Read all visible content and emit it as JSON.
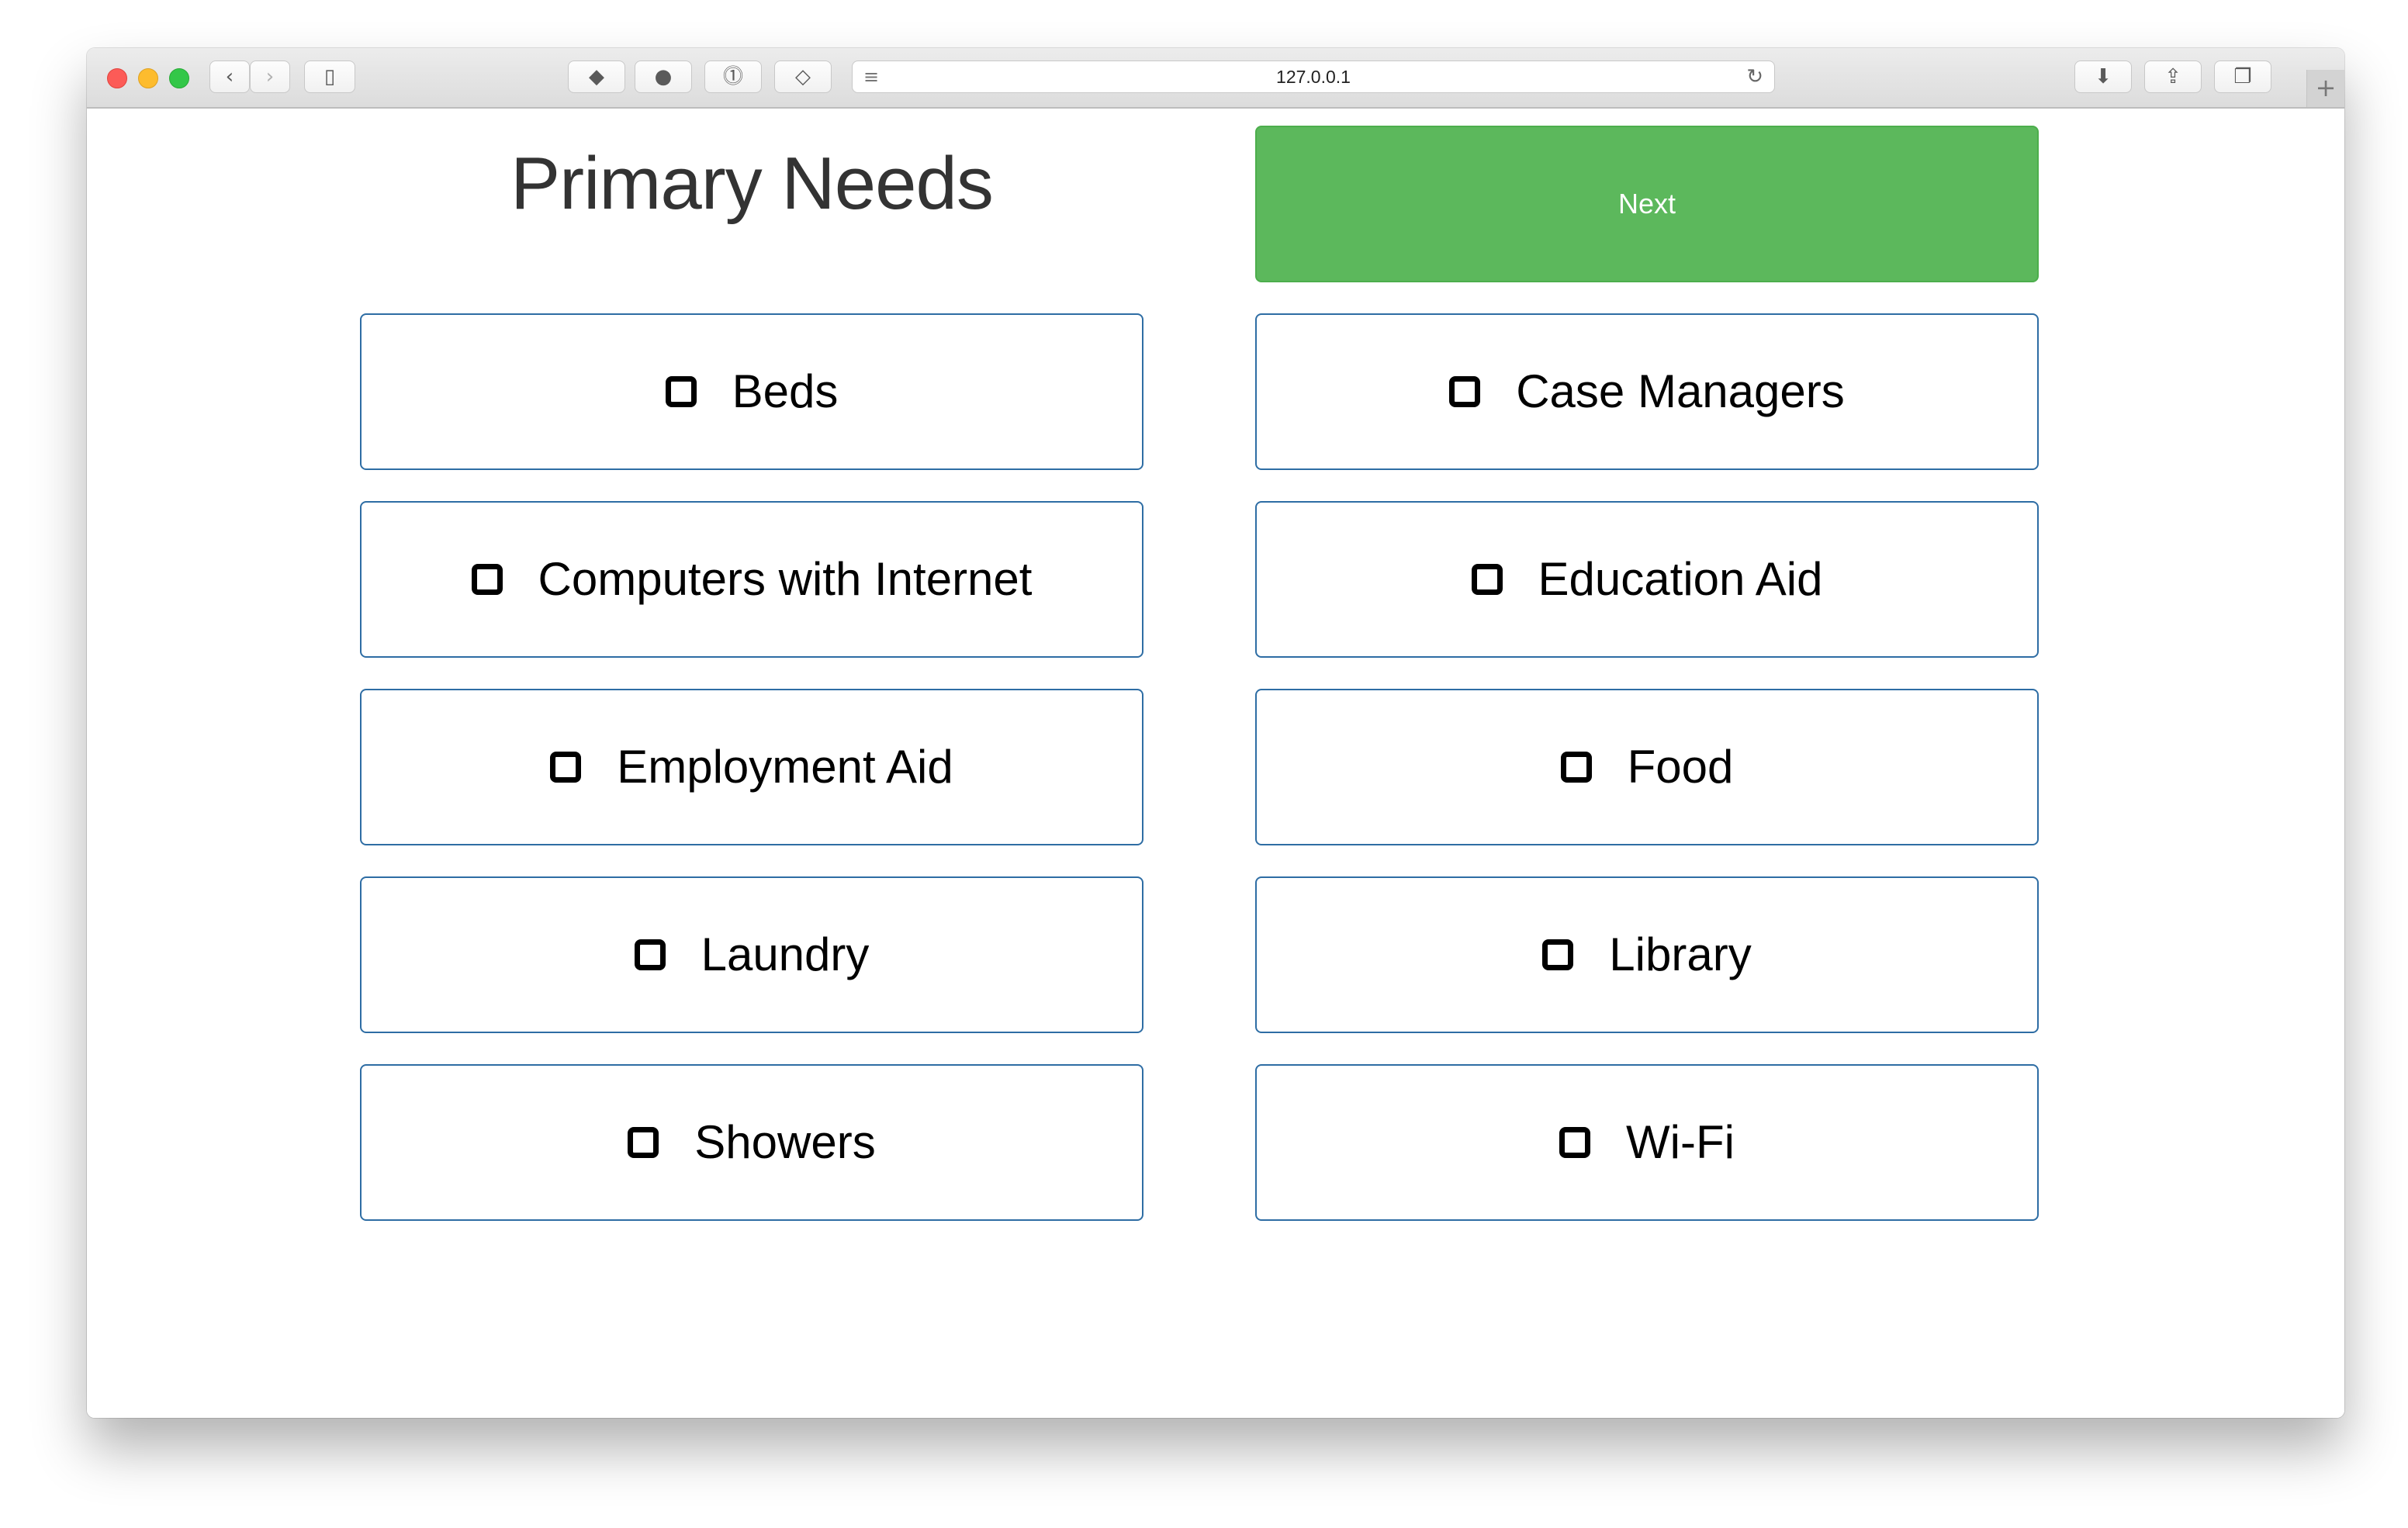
{
  "browser": {
    "url": "127.0.0.1",
    "icons": [
      "back-icon",
      "forward-icon",
      "sidebar-icon",
      "extension-icon",
      "grammar-icon",
      "password-icon",
      "shield-icon",
      "reader-icon",
      "reload-icon",
      "download-icon",
      "share-icon",
      "tabs-icon",
      "new-tab-icon"
    ]
  },
  "page": {
    "title": "Primary Needs",
    "next_label": "Next",
    "accent_color": "#5cb85c",
    "option_border_color": "#2e6da4"
  },
  "options": [
    {
      "label": "Beds",
      "checked": false
    },
    {
      "label": "Case Managers",
      "checked": false
    },
    {
      "label": "Computers with Internet",
      "checked": false
    },
    {
      "label": "Education Aid",
      "checked": false
    },
    {
      "label": "Employment Aid",
      "checked": false
    },
    {
      "label": "Food",
      "checked": false
    },
    {
      "label": "Laundry",
      "checked": false
    },
    {
      "label": "Library",
      "checked": false
    },
    {
      "label": "Showers",
      "checked": false
    },
    {
      "label": "Wi-Fi",
      "checked": false
    }
  ]
}
